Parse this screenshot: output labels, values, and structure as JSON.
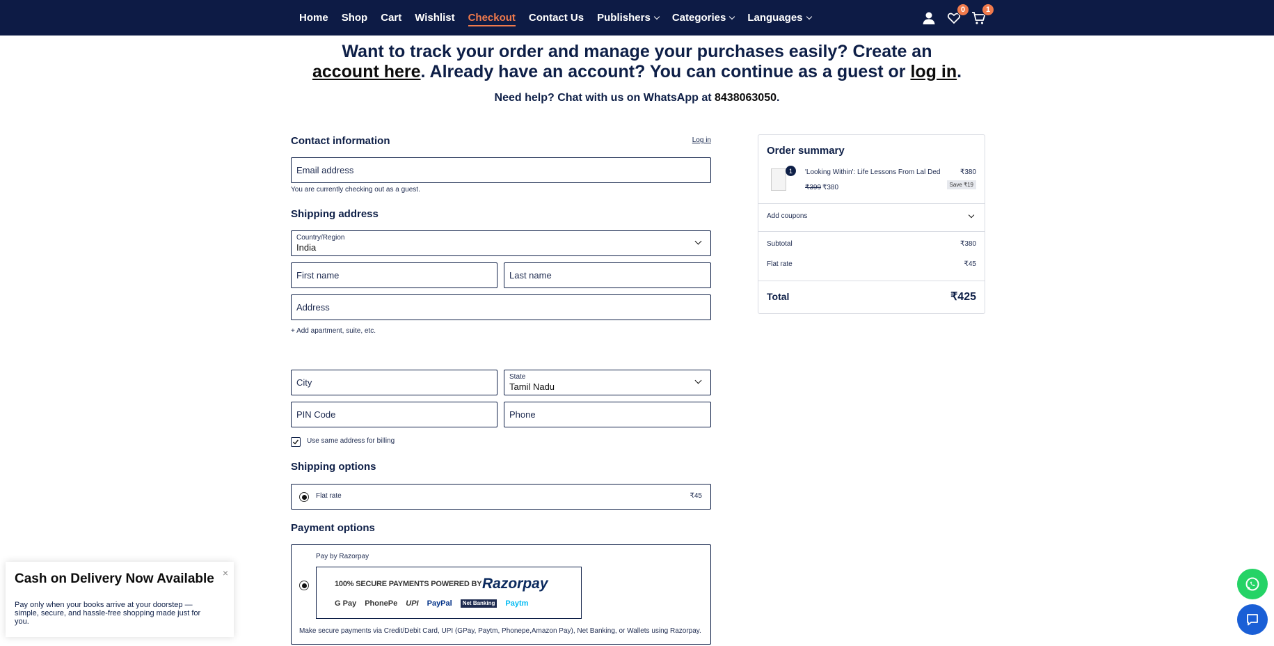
{
  "nav": {
    "links": [
      {
        "label": "Home"
      },
      {
        "label": "Shop"
      },
      {
        "label": "Cart"
      },
      {
        "label": "Wishlist"
      },
      {
        "label": "Checkout"
      },
      {
        "label": "Contact Us"
      },
      {
        "label": "Publishers"
      },
      {
        "label": "Categories"
      },
      {
        "label": "Languages"
      }
    ],
    "wishlist_count": "0",
    "cart_count": "1",
    "icons": [
      "account-icon",
      "heart-icon",
      "cart-icon"
    ]
  },
  "banner": {
    "part1": "Want to track your order and manage your purchases easily? Create an ",
    "account_link": "account here",
    "part2": ". Already have an account? You can continue as a guest or ",
    "login_link": "log in",
    "part3": ".",
    "help_prefix": "Need help? Chat with us on WhatsApp at ",
    "help_phone": "8438063050",
    "help_suffix": "."
  },
  "contact": {
    "title": "Contact information",
    "login": "Log in",
    "email_placeholder": "Email address",
    "guest_note": "You are currently checking out as a guest."
  },
  "shipping": {
    "title": "Shipping address",
    "country_label": "Country/Region",
    "country_value": "India",
    "first_name": "First name",
    "last_name": "Last name",
    "address": "Address",
    "add_apartment": "+ Add apartment, suite, etc.",
    "city": "City",
    "state_label": "State",
    "state_value": "Tamil Nadu",
    "pin": "PIN Code",
    "phone": "Phone",
    "same_billing": "Use same address for billing"
  },
  "shipping_options": {
    "title": "Shipping options",
    "option_label": "Flat rate",
    "option_price": "₹45"
  },
  "payment": {
    "title": "Payment options",
    "method_label": "Pay by Razorpay",
    "razorpay_headline": "100% SECURE PAYMENTS POWERED BY",
    "razorpay_brand": "Razorpay",
    "methods": [
      "G Pay",
      "PhonePe",
      "UPI",
      "PayPal",
      "Net Banking",
      "Paytm"
    ],
    "description": "Make secure payments via Credit/Debit Card, UPI (GPay, Paytm, Phonepe,Amazon Pay), Net Banking, or Wallets using Razorpay."
  },
  "summary": {
    "title": "Order summary",
    "qty": "1",
    "item_name": "'Looking Within': Life Lessons From Lal Ded",
    "item_price": "₹380",
    "item_old_price": "₹399",
    "item_new_price": "₹380",
    "save": "Save ₹19",
    "coupons": "Add coupons",
    "subtotal_label": "Subtotal",
    "subtotal_value": "₹380",
    "flat_label": "Flat rate",
    "flat_value": "₹45",
    "total_label": "Total",
    "total_value": "₹425"
  },
  "cod": {
    "title": "Cash on Delivery Now Available",
    "body": "Pay only when your books arrive at your doorstep — simple, secure, and hassle-free shopping made just for you.",
    "close": "×"
  },
  "colors": {
    "navy": "#0d1b45",
    "accent": "#f07a4c",
    "whatsapp": "#25d366",
    "chat": "#1a5fd6"
  }
}
